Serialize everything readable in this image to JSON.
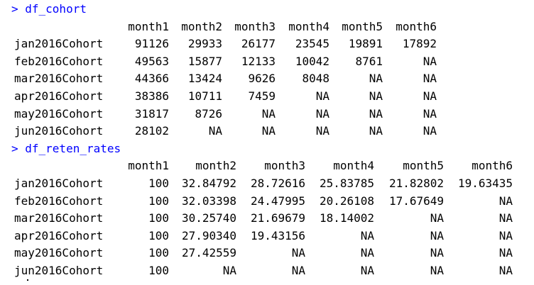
{
  "console": {
    "prompt": "> ",
    "blocks": [
      {
        "command": "df_cohort",
        "columns": [
          "month1",
          "month2",
          "month3",
          "month4",
          "month5",
          "month6"
        ],
        "rows": [
          {
            "name": "jan2016Cohort",
            "values": [
              "91126",
              "29933",
              "26177",
              "23545",
              "19891",
              "17892"
            ]
          },
          {
            "name": "feb2016Cohort",
            "values": [
              "49563",
              "15877",
              "12133",
              "10042",
              "8761",
              "NA"
            ]
          },
          {
            "name": "mar2016Cohort",
            "values": [
              "44366",
              "13424",
              "9626",
              "8048",
              "NA",
              "NA"
            ]
          },
          {
            "name": "apr2016Cohort",
            "values": [
              "38386",
              "10711",
              "7459",
              "NA",
              "NA",
              "NA"
            ]
          },
          {
            "name": "may2016Cohort",
            "values": [
              "31817",
              "8726",
              "NA",
              "NA",
              "NA",
              "NA"
            ]
          },
          {
            "name": "jun2016Cohort",
            "values": [
              "28102",
              "NA",
              "NA",
              "NA",
              "NA",
              "NA"
            ]
          }
        ]
      },
      {
        "command": "df_reten_rates",
        "columns": [
          "month1",
          "month2",
          "month3",
          "month4",
          "month5",
          "month6"
        ],
        "rows": [
          {
            "name": "jan2016Cohort",
            "values": [
              "100",
              "32.84792",
              "28.72616",
              "25.83785",
              "21.82802",
              "19.63435"
            ]
          },
          {
            "name": "feb2016Cohort",
            "values": [
              "100",
              "32.03398",
              "24.47995",
              "20.26108",
              "17.67649",
              "NA"
            ]
          },
          {
            "name": "mar2016Cohort",
            "values": [
              "100",
              "30.25740",
              "21.69679",
              "18.14002",
              "NA",
              "NA"
            ]
          },
          {
            "name": "apr2016Cohort",
            "values": [
              "100",
              "27.90340",
              "19.43156",
              "NA",
              "NA",
              "NA"
            ]
          },
          {
            "name": "may2016Cohort",
            "values": [
              "100",
              "27.42559",
              "NA",
              "NA",
              "NA",
              "NA"
            ]
          },
          {
            "name": "jun2016Cohort",
            "values": [
              "100",
              "NA",
              "NA",
              "NA",
              "NA",
              "NA"
            ]
          }
        ]
      }
    ]
  }
}
